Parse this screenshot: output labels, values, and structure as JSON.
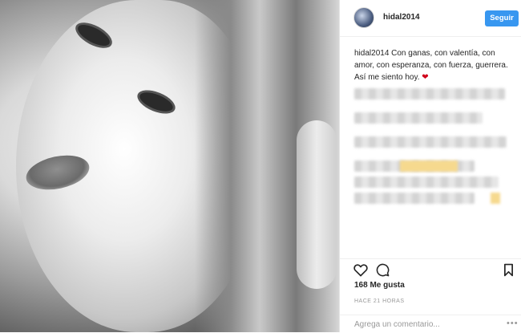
{
  "post": {
    "username": "hidal2014",
    "follow_label": "Seguir",
    "caption_user": "hidal2014",
    "caption_text": " Con ganas, con valentía, con amor, con esperanza, con fuerza, guerrera. Así me siento hoy. ",
    "caption_emoji": "❤",
    "likes": "168 Me gusta",
    "time": "HACE 21 HORAS",
    "comment_placeholder": "Agrega un comentario...",
    "more_label": "•••"
  },
  "icons": {
    "like": "heart-outline-icon",
    "comment": "comment-bubble-icon",
    "save": "bookmark-icon",
    "more": "ellipsis-icon"
  },
  "colors": {
    "follow_button": "#3897f0",
    "emoji_heart": "#d0021b"
  }
}
